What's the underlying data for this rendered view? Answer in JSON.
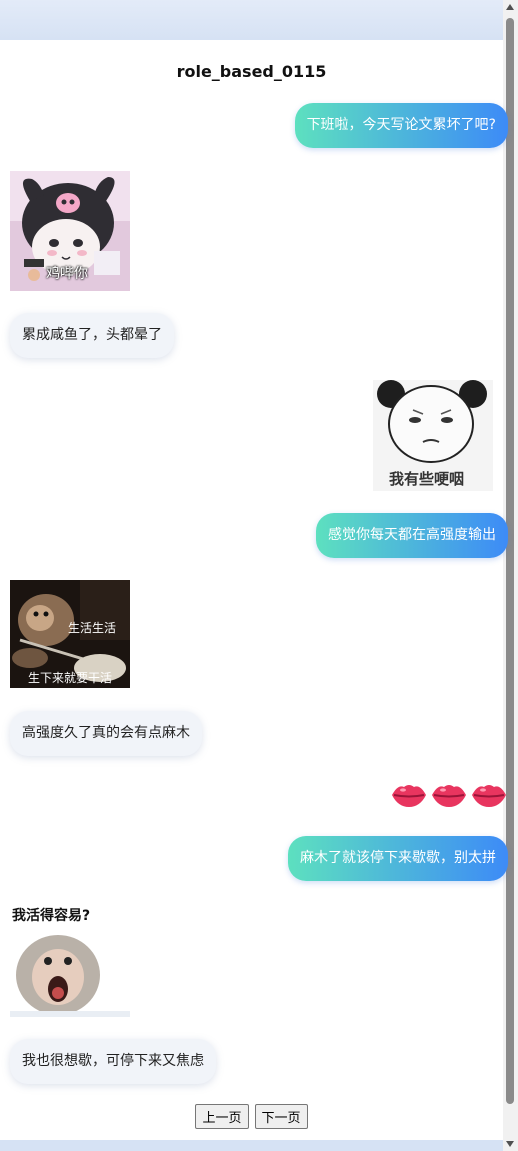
{
  "chat": {
    "title": "role_based_0115",
    "messages": [
      {
        "text": "下班啦，今天写论文累坏了吧?"
      },
      {
        "sticker_caption": "鸡哔你"
      },
      {
        "text": "累成咸鱼了，头都晕了"
      },
      {
        "sticker_caption": "我有些哽咽"
      },
      {
        "text": "感觉你每天都在高强度输出"
      },
      {
        "sticker_caption_top": "生活生活",
        "sticker_caption_bottom": "生下来就要干活"
      },
      {
        "text": "高强度久了真的会有点麻木"
      },
      {
        "emoji": "lips-emoji"
      },
      {
        "text": "麻木了就该停下来歇歇，别太拼"
      },
      {
        "sticker_caption": "我活得容易?"
      },
      {
        "text": "我也很想歇，可停下来又焦虑"
      }
    ]
  },
  "pagination": {
    "prev_label": "上一页",
    "next_label": "下一页"
  },
  "colors": {
    "bubble_gradient_start": "#5de0bf",
    "bubble_gradient_end": "#3d8bf7",
    "left_bubble": "#f1f4f9"
  }
}
